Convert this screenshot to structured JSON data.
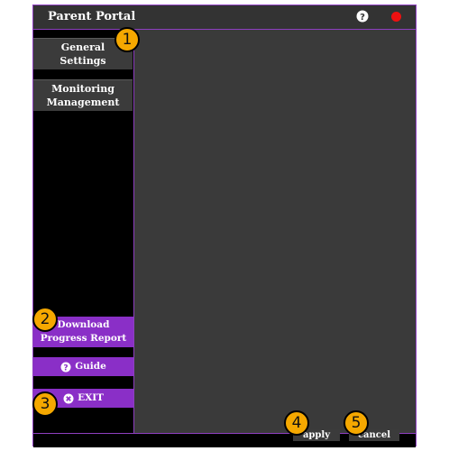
{
  "window": {
    "title": "Parent Portal"
  },
  "sidebar": {
    "items": [
      {
        "line1": "General",
        "line2": "Settings"
      },
      {
        "line1": "Monitoring",
        "line2": "Management"
      }
    ],
    "download": {
      "line1": "Download",
      "line2": "Progress Report"
    },
    "guide": {
      "label": "Guide",
      "icon": "question-icon"
    },
    "exit": {
      "label": "EXIT",
      "icon": "close-circle-icon"
    }
  },
  "footer": {
    "apply_label": "apply",
    "cancel_label": "cancel"
  },
  "callouts": [
    "1",
    "2",
    "3",
    "4",
    "5"
  ],
  "colors": {
    "accent": "#8a2fc7",
    "badge": "#f5a800",
    "close": "#ee1111"
  }
}
